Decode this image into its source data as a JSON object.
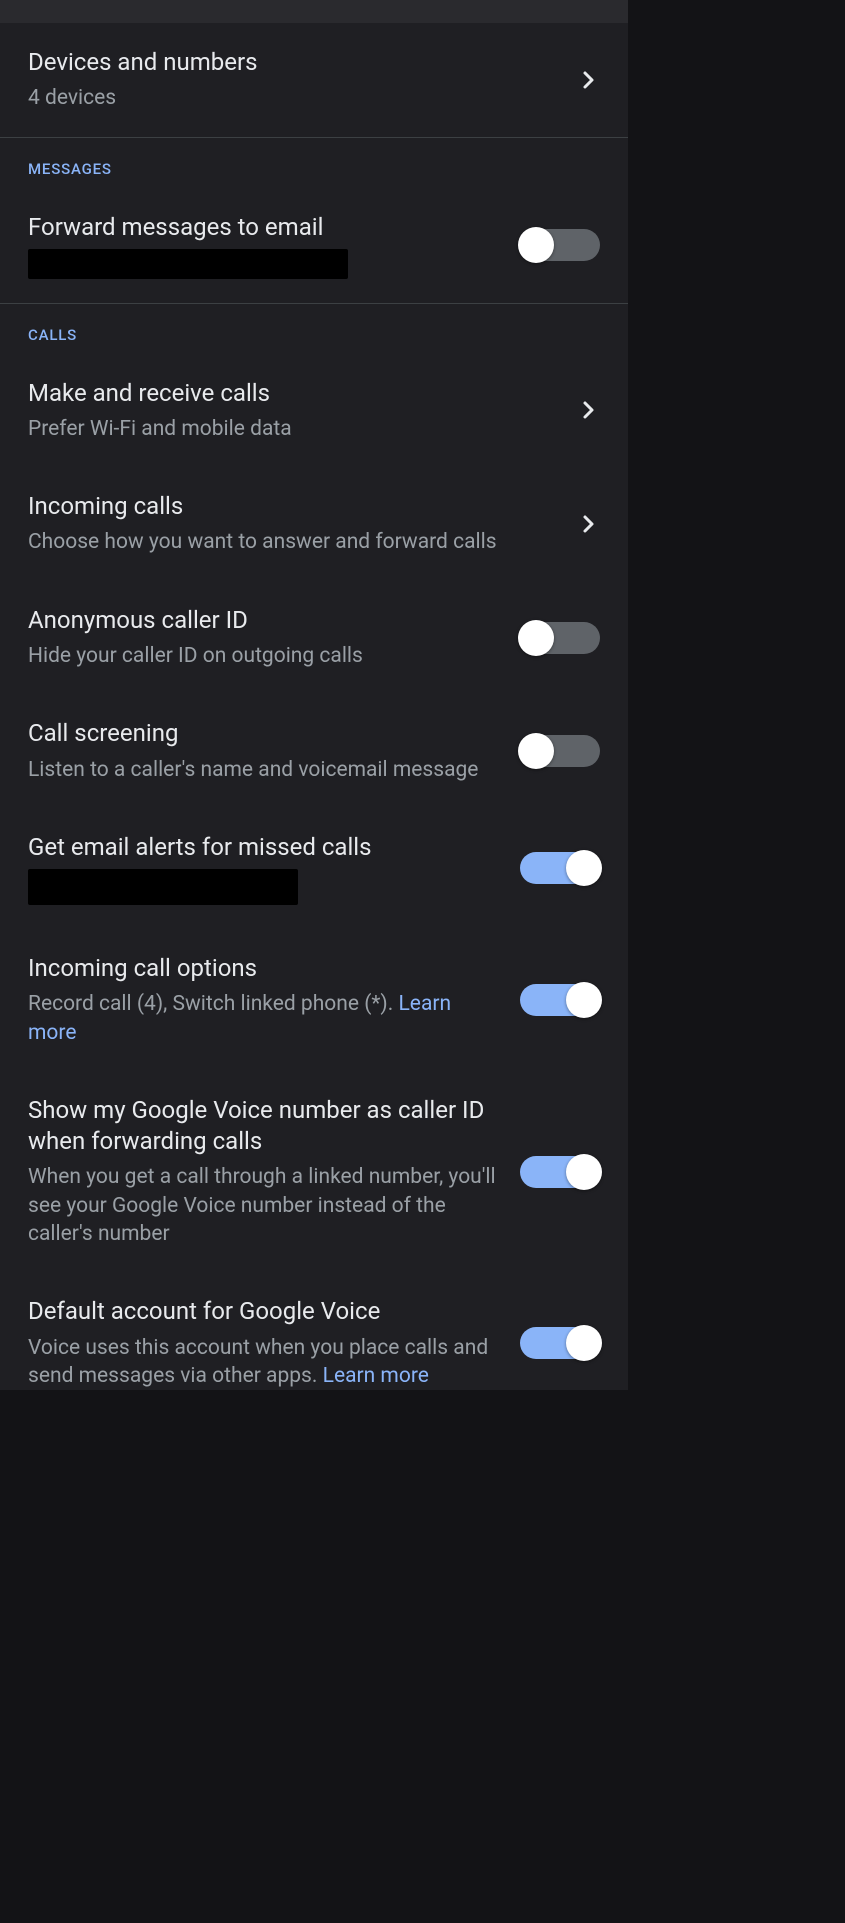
{
  "sections": {
    "top": {
      "devices": {
        "title": "Devices and numbers",
        "subtitle": "4 devices"
      }
    },
    "messages": {
      "header": "MESSAGES",
      "forward": {
        "title": "Forward messages to email"
      }
    },
    "calls": {
      "header": "CALLS",
      "make": {
        "title": "Make and receive calls",
        "subtitle": "Prefer Wi-Fi and mobile data"
      },
      "incoming": {
        "title": "Incoming calls",
        "subtitle": "Choose how you want to answer and forward calls"
      },
      "anon": {
        "title": "Anonymous caller ID",
        "subtitle": "Hide your caller ID on outgoing calls"
      },
      "screening": {
        "title": "Call screening",
        "subtitle": "Listen to a caller's name and voicemail message"
      },
      "missed": {
        "title": "Get email alerts for missed calls"
      },
      "options": {
        "title": "Incoming call options",
        "subtitle_pre": "Record call (4), Switch linked phone (*). ",
        "learn_more": "Learn more"
      },
      "callerid": {
        "title": "Show my Google Voice number as caller ID when forwarding calls",
        "subtitle": "When you get a call through a linked number, you'll see your Google Voice number instead of the caller's number"
      },
      "default": {
        "title": "Default account for Google Voice",
        "subtitle_pre": "Voice uses this account when you place calls and send messages via other apps. ",
        "learn_more": "Learn more"
      }
    }
  }
}
